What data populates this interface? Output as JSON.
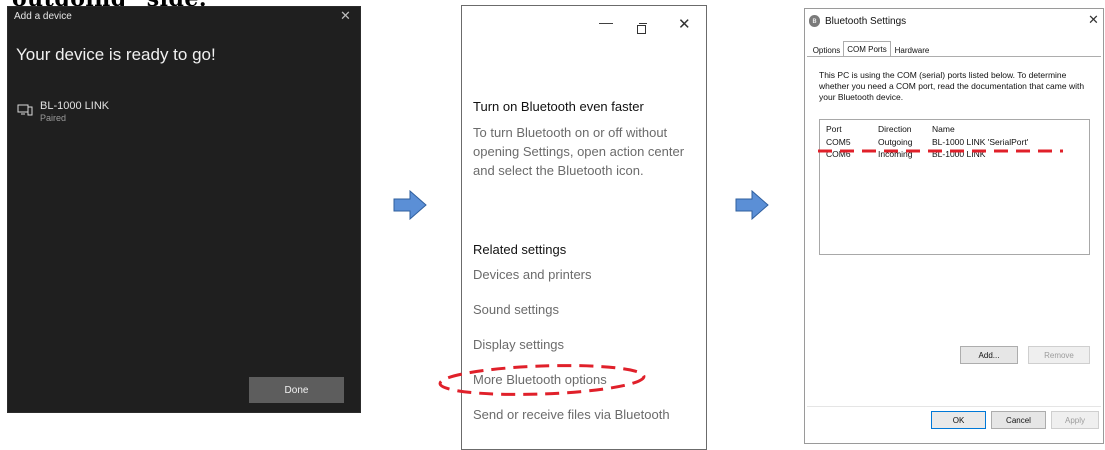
{
  "heading_crop": "outgoing\" side.",
  "add_device": {
    "window_title": "Add a device",
    "heading": "Your device is ready to go!",
    "device_name": "BL-1000 LINK",
    "device_status": "Paired",
    "done_label": "Done"
  },
  "related": {
    "section1_title": "Turn on Bluetooth even faster",
    "section1_body": "To turn Bluetooth on or off without opening Settings, open action center and select the Bluetooth icon.",
    "section2_title": "Related settings",
    "links": [
      "Devices and printers",
      "Sound settings",
      "Display settings",
      "More Bluetooth options",
      "Send or receive files via Bluetooth"
    ]
  },
  "bt_settings": {
    "window_title": "Bluetooth Settings",
    "tabs": [
      "Options",
      "COM Ports",
      "Hardware"
    ],
    "active_tab": "COM Ports",
    "description": "This PC is using the COM (serial) ports listed below. To determine whether you need a COM port, read the documentation that came with your Bluetooth device.",
    "columns": [
      "Port",
      "Direction",
      "Name"
    ],
    "rows": [
      [
        "COM5",
        "Outgoing",
        "BL-1000 LINK 'SerialPort'"
      ],
      [
        "COM6",
        "Incoming",
        "BL-1000 LINK"
      ]
    ],
    "add_label": "Add...",
    "remove_label": "Remove",
    "ok_label": "OK",
    "cancel_label": "Cancel",
    "apply_label": "Apply"
  },
  "colors": {
    "annotation_red": "#e0202a",
    "arrow_blue": "#5b8fd6",
    "dark_bg": "#1f1f1f"
  }
}
